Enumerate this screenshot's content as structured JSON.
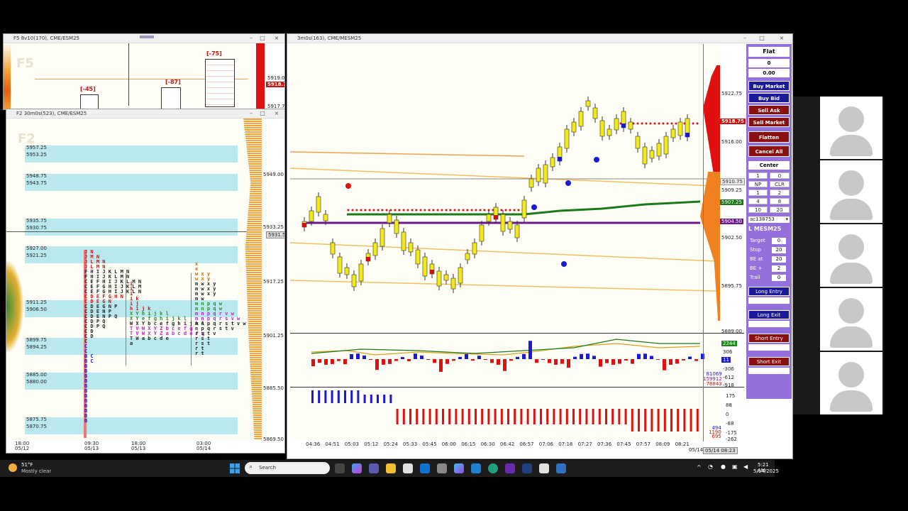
{
  "window_f5": {
    "title": "F5 8v10(170), CME/ESM25",
    "watermark": "F5",
    "prices": [
      "5919.00",
      "5917.75"
    ],
    "current": "5918.75",
    "deltas": [
      "[-75]",
      "[-45]",
      "[-87]"
    ]
  },
  "window_f2": {
    "title": "F2 30m0s(523), CME/ESM25",
    "watermark": "F2",
    "band_labels": [
      "5957.25",
      "5953.25",
      "5948.75",
      "5943.75",
      "5935.75",
      "5930.75",
      "5927.00",
      "5921.25",
      "5911.25",
      "5906.50",
      "5899.75",
      "5894.25",
      "5885.00",
      "5880.00",
      "5875.75",
      "5870.75"
    ],
    "axis_prices": [
      "5949.00",
      "5933.25",
      "5917.25",
      "5901.25",
      "5885.50",
      "5869.50"
    ],
    "axis_tag": "5931.50",
    "time_labels": [
      {
        "t": "18:00",
        "d": "05/12"
      },
      {
        "t": "09:30",
        "d": "05/13"
      },
      {
        "t": "18:00",
        "d": "05/13"
      },
      {
        "t": "03:00",
        "d": "05/14"
      }
    ],
    "tpo_left": [
      "J N",
      "J M N",
      "J L M N",
      "J L M N",
      "F H I J K L M N",
      "F H I J K L M N",
      "C E F H I J K L M N",
      "C E F G H I J K L M",
      "C E F G H I J K L N",
      "C D E F G H N",
      "C D E G N",
      "C D E G N P",
      "C D E N P",
      "C D E N P Q",
      "C D P Q",
      "C D P Q",
      "C D",
      "C D",
      "C",
      "C",
      "C",
      "B C",
      "B C",
      "B",
      "B",
      "B",
      "B",
      "B",
      "B",
      "B",
      "B",
      "B",
      "B",
      "B",
      "B"
    ],
    "tpo_mid": [
      "i",
      "i",
      "i",
      "i k",
      "i j",
      "h i j k",
      "X Y h i j k l",
      "X Y e f g h i j k l",
      "W X Y b c e f g h i j k l",
      "T V W X Y Z b c e f g",
      "T V W X Y Z a b c d e f g",
      "T W a b c d e",
      "a"
    ],
    "tpo_right": [
      "x",
      "x",
      "w x y",
      "w x y",
      "m w x y",
      "m w x y",
      "m w x y",
      "m w",
      "m n p q w",
      "m n p q w",
      "m n p q r v w",
      "m n p q r s v w",
      "m n p q r s t v w",
      "n p q r s t v",
      "r s t v",
      "r s t",
      "r s t",
      "r t",
      "r t"
    ]
  },
  "window_main": {
    "title": "3m0s(163), CME/MESM25",
    "axis_prices": [
      "5922.75",
      "5916.00",
      "5909.25",
      "5902.50",
      "5895.75",
      "5889.00"
    ],
    "tags": {
      "last": "5918.75",
      "green": "5907.25",
      "purple": "5904.50",
      "grey": "5910.75"
    },
    "time_labels": [
      "04:36",
      "04:51",
      "05:03",
      "05:12",
      "05:24",
      "05:33",
      "05:45",
      "06:00",
      "06:15",
      "06:30",
      "06:42",
      "06:57",
      "07:06",
      "07:18",
      "07:27",
      "07:36",
      "07:45",
      "07:57",
      "08:09",
      "08:21"
    ],
    "last_date": "05/14",
    "cursor_label": "05/14 08:23",
    "delta_axis": [
      "2244",
      "306",
      "0",
      "-306",
      "-612",
      "-918"
    ],
    "delta_box": "11",
    "delta_readouts": [
      "81069",
      "159912",
      "78843"
    ],
    "cum_axis": [
      "175",
      "88",
      "0",
      "-88",
      "-175",
      "-262"
    ],
    "cum_readouts": [
      "494",
      "1190",
      "695"
    ]
  },
  "trade_panel": {
    "position": "Flat",
    "qty": "0",
    "pnl": "0.00",
    "buttons": {
      "buy_market": "Buy Market",
      "buy_bid": "Buy Bid",
      "sell_ask": "Sell Ask",
      "sell_market": "Sell Market",
      "flatten": "Flatten",
      "cancel_all": "Cancel All",
      "center": "Center"
    },
    "qty_row": [
      "1",
      "0"
    ],
    "np_label": "NP",
    "clr_label": "CLR",
    "grid": [
      [
        "1",
        "2"
      ],
      [
        "4",
        "8"
      ],
      [
        "10",
        "20"
      ]
    ],
    "account": "ac138753",
    "symbol": "L MESM25",
    "fields": [
      {
        "label": "Target",
        "value": "0"
      },
      {
        "label": "Stop",
        "value": "20"
      },
      {
        "label": "BE at",
        "value": "20"
      },
      {
        "label": "BE +",
        "value": "2"
      },
      {
        "label": "Trail",
        "value": "0"
      }
    ],
    "sections": {
      "long_entry": "Long Entry",
      "long_exit": "Long Exit",
      "short_entry": "Short Entry",
      "short_exit": "Short Exit"
    }
  },
  "taskbar": {
    "weather_temp": "51°F",
    "weather_desc": "Mostly clear",
    "search_placeholder": "Search",
    "time": "5:21 AM",
    "date": "5/14/2025"
  },
  "colors": {
    "buy_blue": "#1a1ad6",
    "sell_red": "#cc1111",
    "panel_purple": "#9370db",
    "band_cyan": "#b9e9ef",
    "volume_orange": "#f2a43a"
  }
}
